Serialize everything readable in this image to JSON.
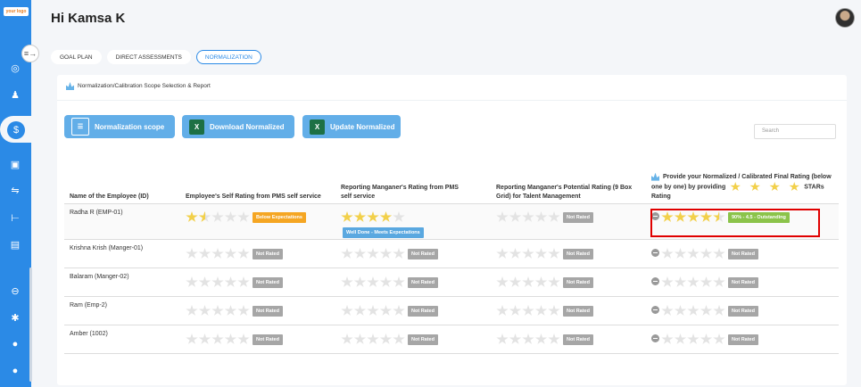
{
  "app": {
    "logo_text": "your logo"
  },
  "header": {
    "greeting": "Hi Kamsa K"
  },
  "tabs": [
    {
      "label": "GOAL PLAN",
      "active": false
    },
    {
      "label": "DIRECT ASSESSMENTS",
      "active": false
    },
    {
      "label": "NORMALIZATION",
      "active": true
    }
  ],
  "card": {
    "title": "Normalization/Calibration Scope Selection & Report",
    "buttons": {
      "scope": "Normalization scope",
      "download": "Download Normalized",
      "update": "Update Normalized"
    },
    "search_placeholder": "Search"
  },
  "table": {
    "headers": {
      "name": "Name of the Employee (ID)",
      "self": "Employee's Self Rating from PMS self service",
      "manager": "Reporting Manganer's Rating from PMS self service",
      "potential": "Reporting Manganer's Potential Rating (9 Box Grid) for Talent Management",
      "final_pre": "Provide your Normalized / Calibrated Final Rating (below one by one) by providing",
      "final_post": "STARs Rating"
    },
    "rows": [
      {
        "name": "Radha R (EMP-01)",
        "self_stars": 1.5,
        "self_badge": "Below Expectations",
        "mgr_stars": 4,
        "mgr_badge": "Well Done - Meets Expectations",
        "pot_stars": 0,
        "pot_badge": "Not Rated",
        "final_stars": 4.5,
        "final_badge": "90% - 4.5 - Outstanding"
      },
      {
        "name": "Krishna Krish (Manger-01)",
        "self_stars": 0,
        "self_badge": "Not Rated",
        "mgr_stars": 0,
        "mgr_badge": "Not Rated",
        "pot_stars": 0,
        "pot_badge": "Not Rated",
        "final_stars": 0,
        "final_badge": "Not Rated"
      },
      {
        "name": "Balaram (Manger-02)",
        "self_stars": 0,
        "self_badge": "Not Rated",
        "mgr_stars": 0,
        "mgr_badge": "Not Rated",
        "pot_stars": 0,
        "pot_badge": "Not Rated",
        "final_stars": 0,
        "final_badge": "Not Rated"
      },
      {
        "name": "Ram (Emp-2)",
        "self_stars": 0,
        "self_badge": "Not Rated",
        "mgr_stars": 0,
        "mgr_badge": "Not Rated",
        "pot_stars": 0,
        "pot_badge": "Not Rated",
        "final_stars": 0,
        "final_badge": "Not Rated"
      },
      {
        "name": "Amber (1002)",
        "self_stars": 0,
        "self_badge": "Not Rated",
        "mgr_stars": 0,
        "mgr_badge": "Not Rated",
        "pot_stars": 0,
        "pot_badge": "Not Rated",
        "final_stars": 0,
        "final_badge": "Not Rated"
      }
    ]
  },
  "colors": {
    "primary": "#2b8ae6",
    "button": "#62aee8",
    "star": "#f2d04a",
    "highlight": "#e00000"
  }
}
